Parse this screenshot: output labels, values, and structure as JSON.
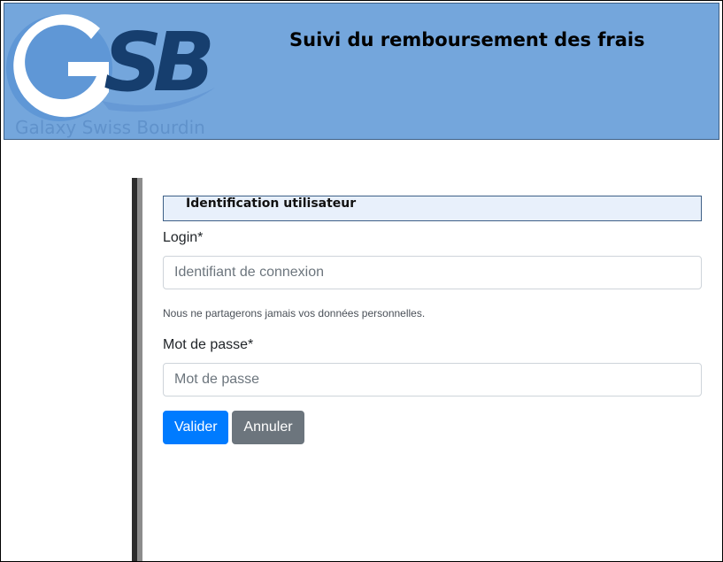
{
  "header": {
    "logo_text": "GSB",
    "logo_caption": "Galaxy Swiss Bourdin",
    "title": "Suivi du remboursement des frais",
    "background_color": "#74a6dc"
  },
  "form": {
    "legend": "Identification utilisateur",
    "login": {
      "label": "Login*",
      "value": "",
      "placeholder": "Identifiant de connexion",
      "help": "Nous ne partagerons jamais vos données personnelles."
    },
    "password": {
      "label": "Mot de passe*",
      "value": "",
      "placeholder": "Mot de passe"
    },
    "buttons": {
      "submit_label": "Valider",
      "cancel_label": "Annuler"
    },
    "colors": {
      "primary": "#007bff",
      "secondary": "#6c757d"
    }
  }
}
